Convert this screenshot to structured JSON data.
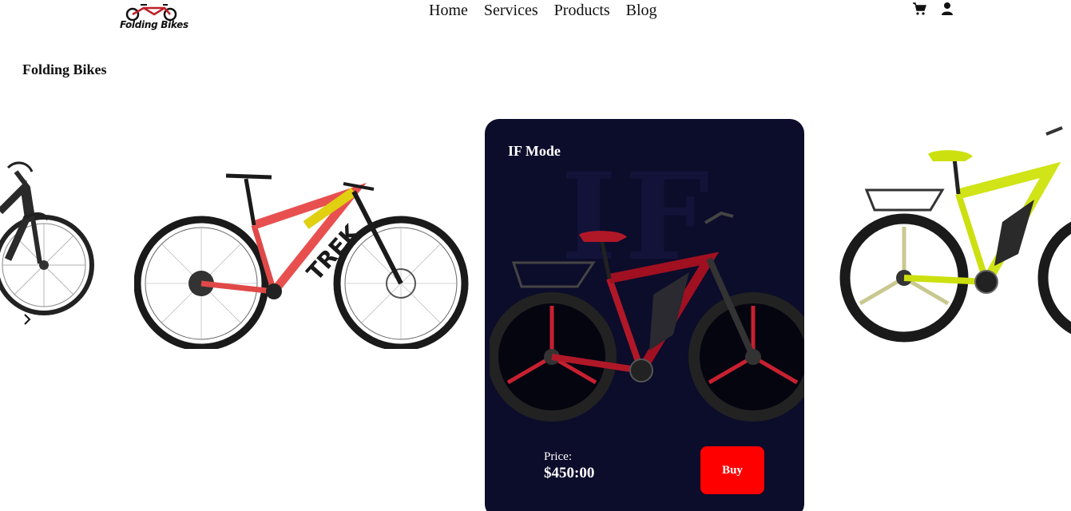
{
  "header": {
    "logo_text": "Folding Bikes",
    "nav": [
      "Home",
      "Services",
      "Products",
      "Blog"
    ],
    "icons": [
      "cart-icon",
      "user-icon"
    ]
  },
  "section": {
    "title": "Folding Bikes"
  },
  "carousel": {
    "arrow_icon": "chevron-right-icon",
    "featured": {
      "title": "IF Mode",
      "watermark": "IF",
      "price_label": "Price:",
      "price_value": "$450:00",
      "buy_label": "Buy"
    }
  },
  "colors": {
    "card_bg": "#0c0c2b",
    "buy_button": "#ff0000",
    "text": "#111111"
  }
}
